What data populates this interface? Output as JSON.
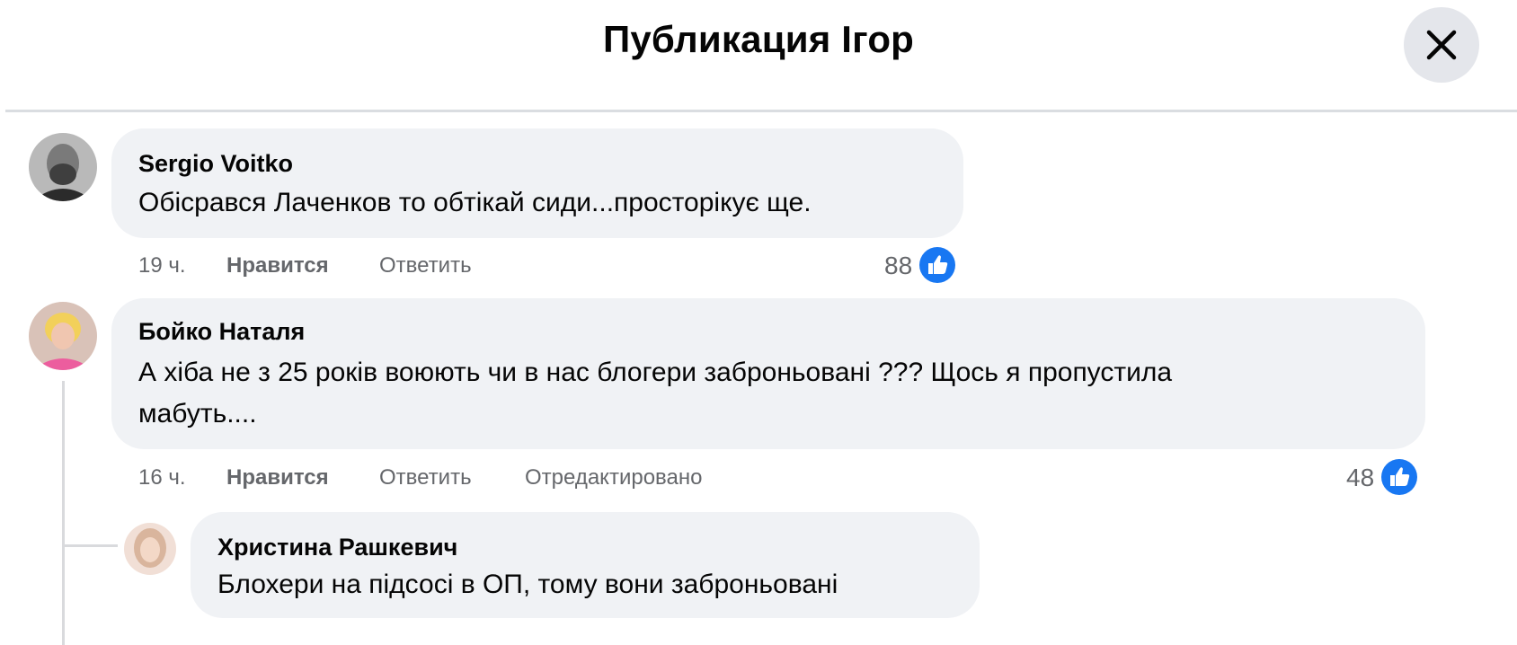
{
  "header": {
    "title": "Публикация Ігор"
  },
  "icons": {
    "close": "close-icon",
    "like": "like-thumb-icon"
  },
  "colors": {
    "like_blue": "#1877f2",
    "bubble": "#f0f2f5",
    "meta": "#65676b"
  },
  "comments": [
    {
      "author": "Sergio Voitko",
      "text": "Обісрався Лаченков то обтікай сиди...просторікує ще.",
      "time": "19 ч.",
      "like_label": "Нравится",
      "reply_label": "Ответить",
      "likes": "88"
    },
    {
      "author": "Бойко Наталя",
      "text_line1": "А хіба не з 25 років воюють чи в нас блогери заброньовані ??? Щось я пропустила",
      "text_line2": "мабуть....",
      "time": "16 ч.",
      "like_label": "Нравится",
      "reply_label": "Ответить",
      "edited_label": "Отредактировано",
      "likes": "48"
    },
    {
      "author": "Христина Рашкевич",
      "text": "Блохери на підсосі в ОП, тому вони заброньовані"
    }
  ]
}
